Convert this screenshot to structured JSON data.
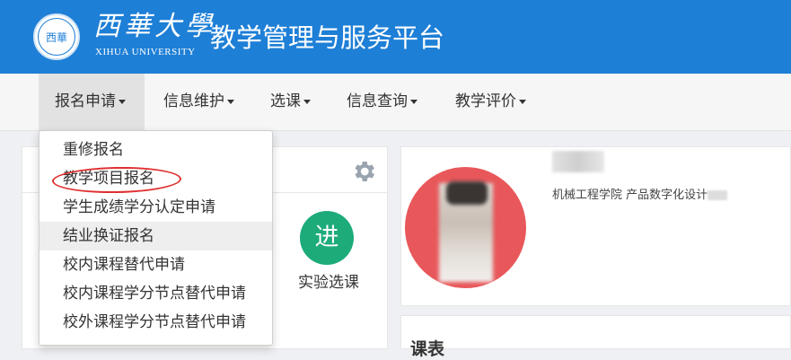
{
  "header": {
    "univ_cn": "西華大學",
    "univ_en": "XIHUA UNIVERSITY",
    "seal_text": "西華",
    "system_title": "教学管理与服务平台",
    "bg_color": "#1e7fd6"
  },
  "nav": {
    "items": [
      {
        "label": "报名申请",
        "active": true
      },
      {
        "label": "信息维护"
      },
      {
        "label": "选课"
      },
      {
        "label": "信息查询"
      },
      {
        "label": "教学评价"
      }
    ]
  },
  "dropdown": {
    "items": [
      {
        "label": "重修报名"
      },
      {
        "label": "教学项目报名",
        "annotated": true
      },
      {
        "label": "学生成绩学分认定申请"
      },
      {
        "label": "结业换证报名",
        "hovered": true
      },
      {
        "label": "校内课程替代申请"
      },
      {
        "label": "校内课程学分节点替代申请"
      },
      {
        "label": "校外课程学分节点替代申请"
      }
    ],
    "annotation_color": "#e03030"
  },
  "left_panel": {
    "jin_badge": "进",
    "shiyan_label": "实验选课",
    "gear_icon": "gear-icon",
    "badge_color": "#1dab7a"
  },
  "profile": {
    "college": "机械工程学院 产品数字化设计",
    "avatar_bg": "#e8585b"
  },
  "bottom_panel": {
    "title": "课表"
  }
}
